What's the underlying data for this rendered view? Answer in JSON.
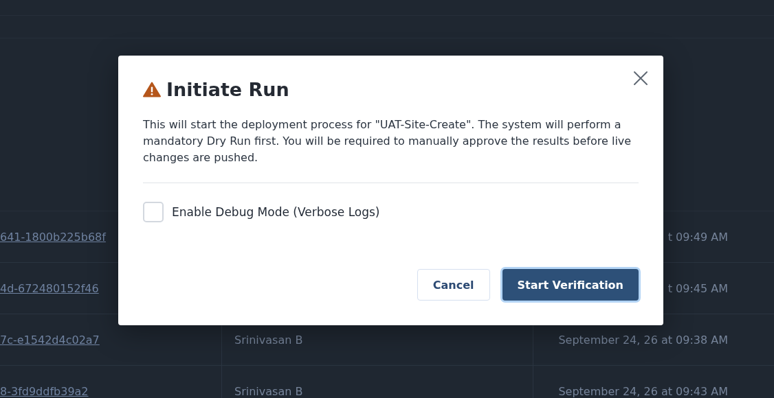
{
  "table": {
    "rows": [
      {
        "column_1": "641-1800b225b68f",
        "column_3": "t 09:49 AM"
      },
      {
        "column_1": "4d-672480152f46",
        "column_3": "t 09:45 AM"
      },
      {
        "column_1": "7c-e1542d4c02a7",
        "column_2": "Srinivasan B",
        "column_3": "September 24, 26 at 09:38 AM"
      },
      {
        "column_1": "8-3fd9ddfb39a2",
        "column_2": "Srinivasan B",
        "column_3": "September 24, 26 at 09:43 AM"
      }
    ]
  },
  "dialog": {
    "title": "Initiate Run",
    "message": "This will start the deployment process for \"UAT-Site-Create\". The system will perform a mandatory Dry Run first. You will be required to manually approve the results before live changes are pushed.",
    "checkbox": {
      "label": "Enable Debug Mode (Verbose Logs)",
      "checked": false
    },
    "buttons": [
      {
        "label": "Cancel",
        "kind": "secondary"
      },
      {
        "label": "Start Verification",
        "kind": "primary"
      }
    ]
  }
}
